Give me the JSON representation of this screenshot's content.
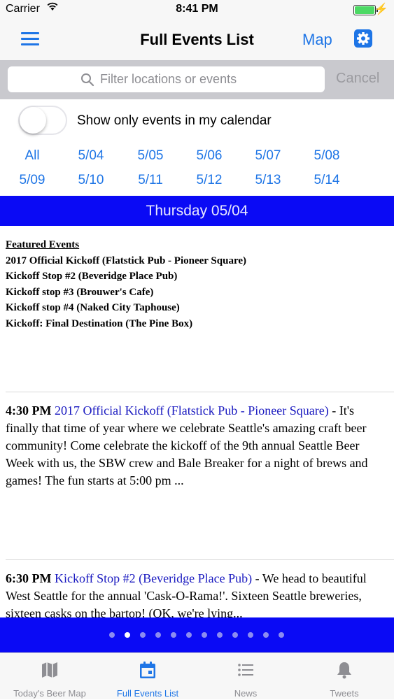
{
  "status": {
    "carrier": "Carrier",
    "time": "8:41 PM"
  },
  "nav": {
    "title": "Full Events List",
    "map_label": "Map"
  },
  "search": {
    "placeholder": "Filter locations or events",
    "cancel_label": "Cancel"
  },
  "filter": {
    "label": "Show only events in my calendar",
    "on": false
  },
  "dates": [
    "All",
    "5/04",
    "5/05",
    "5/06",
    "5/07",
    "5/08",
    "5/09",
    "5/10",
    "5/11",
    "5/12",
    "5/13",
    "5/14"
  ],
  "day_header": "Thursday 05/04",
  "featured": {
    "heading": "Featured Events",
    "items": [
      "2017 Official Kickoff (Flatstick Pub - Pioneer Square)",
      "Kickoff Stop #2 (Beveridge Place Pub)",
      "Kickoff stop #3 (Brouwer's Cafe)",
      "Kickoff stop #4 (Naked City Taphouse)",
      "Kickoff: Final Destination (The Pine Box)"
    ]
  },
  "events": [
    {
      "time": "4:30 PM",
      "title": "2017 Official Kickoff (Flatstick Pub - Pioneer Square)",
      "desc": " - It's finally that time of year where we celebrate Seattle's amazing craft beer community! Come celebrate the kickoff of the 9th annual Seattle Beer Week with us, the SBW crew and Bale Breaker for a night of brews and games! The fun starts at 5:00 pm ..."
    },
    {
      "time": "6:30 PM",
      "title": "Kickoff Stop #2 (Beveridge Place Pub)",
      "desc": " - We head to beautiful West Seattle for the annual 'Cask-O-Rama!'. Sixteen Seattle breweries, sixteen casks on the bartop! (OK, we're lying..."
    }
  ],
  "pager": {
    "count": 11,
    "active": 1
  },
  "tabs": [
    {
      "label": "Today's Beer Map",
      "icon": "map-icon"
    },
    {
      "label": "Full Events List",
      "icon": "calendar-icon"
    },
    {
      "label": "News",
      "icon": "list-icon"
    },
    {
      "label": "Tweets",
      "icon": "bell-icon"
    }
  ],
  "active_tab": 1,
  "colors": {
    "accent": "#1e75e6",
    "day_bar": "#0a0af5",
    "link": "#1a1ac0"
  }
}
